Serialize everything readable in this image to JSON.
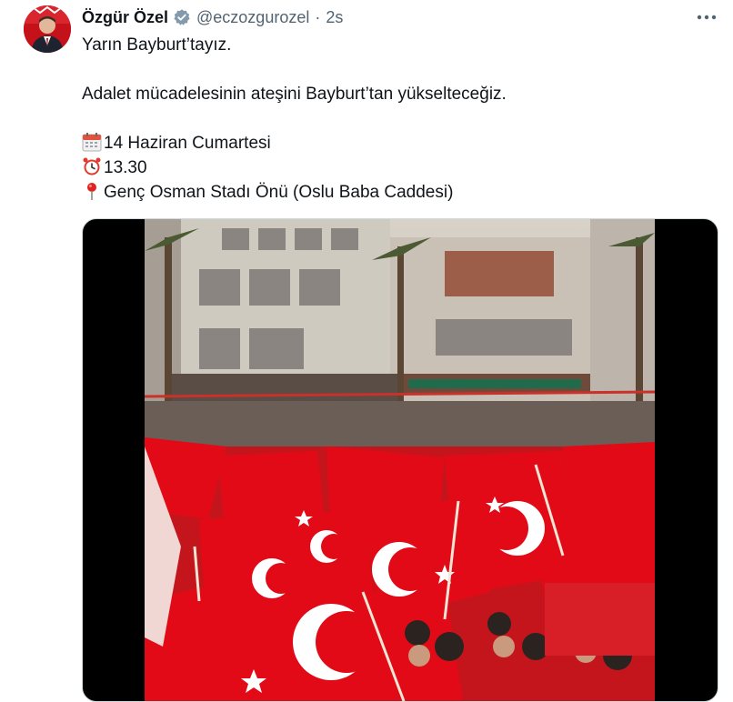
{
  "author": {
    "name": "Özgür Özel",
    "handle": "@eczozgurozel",
    "separator": "·",
    "time": "2s",
    "verified_icon": "verified-badge-icon"
  },
  "more_icon": "more-horizontal-icon",
  "tweet": {
    "line1": "Yarın Bayburt’tayız.",
    "line2": "Adalet mücadelesinin ateşini Bayburt’tan yükselteceğiz.",
    "date": "14 Haziran Cumartesi",
    "time": "13.30",
    "location": "Genç Osman Stadı Önü (Oslu Baba Caddesi)",
    "icons": [
      "calendar-icon",
      "alarm-clock-icon",
      "pin-icon"
    ]
  },
  "media": {
    "type": "video",
    "description_icon": "video-thumbnail"
  },
  "colors": {
    "text": "#0f1419",
    "secondary": "#536471",
    "verified": "#829aab",
    "flag_red": "#e30a17",
    "border": "#cfd9de"
  }
}
